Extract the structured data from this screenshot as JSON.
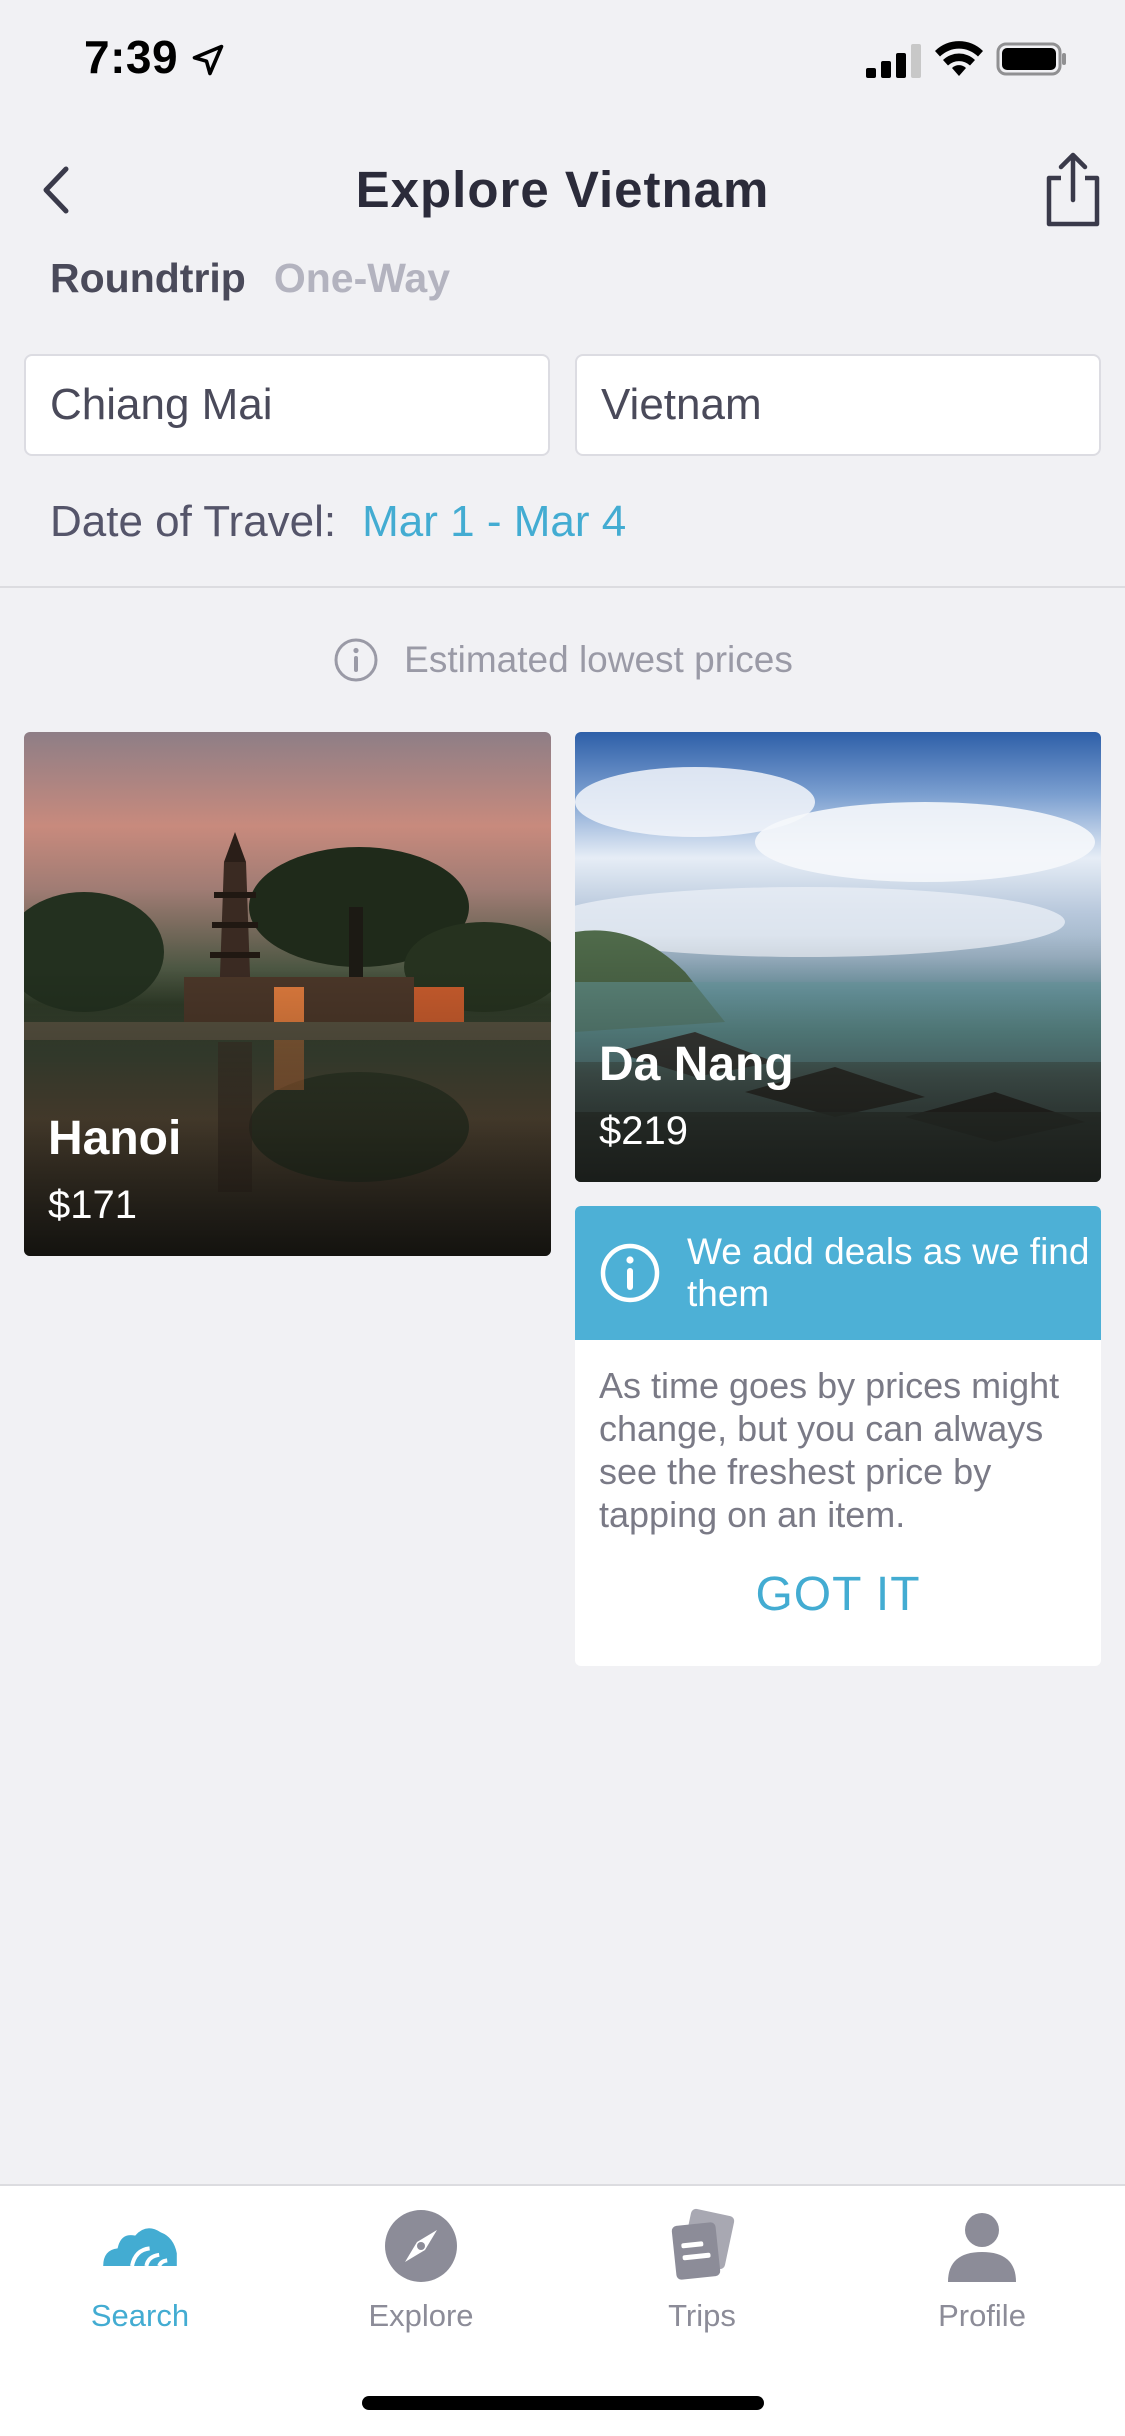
{
  "status_bar": {
    "time": "7:39",
    "icons": [
      "location-arrow-icon",
      "cellular-signal-icon",
      "wifi-icon",
      "battery-icon"
    ]
  },
  "header": {
    "title": "Explore Vietnam",
    "back_icon": "chevron-left-icon",
    "share_icon": "share-icon"
  },
  "trip_type": {
    "options": [
      "Roundtrip",
      "One-Way"
    ],
    "selected": "Roundtrip"
  },
  "search": {
    "origin": "Chiang Mai",
    "destination": "Vietnam",
    "date_label": "Date of Travel:",
    "date_value": "Mar 1 - Mar 4"
  },
  "estimate_note": "Estimated lowest prices",
  "destinations": [
    {
      "city": "Hanoi",
      "price": "$171"
    },
    {
      "city": "Da Nang",
      "price": "$219"
    }
  ],
  "info_card": {
    "title": "We add deals as we find them",
    "body": "As time goes by prices might change, but you can always see the freshest price by tapping on an item.",
    "action": "GOT IT"
  },
  "tab_bar": {
    "items": [
      {
        "label": "Search",
        "icon": "search-logo-icon"
      },
      {
        "label": "Explore",
        "icon": "compass-icon"
      },
      {
        "label": "Trips",
        "icon": "trips-icon"
      },
      {
        "label": "Profile",
        "icon": "profile-icon"
      }
    ],
    "active": "Search"
  },
  "colors": {
    "accent": "#43acd2",
    "info_header": "#4db0d6",
    "background": "#f1f1f4"
  }
}
